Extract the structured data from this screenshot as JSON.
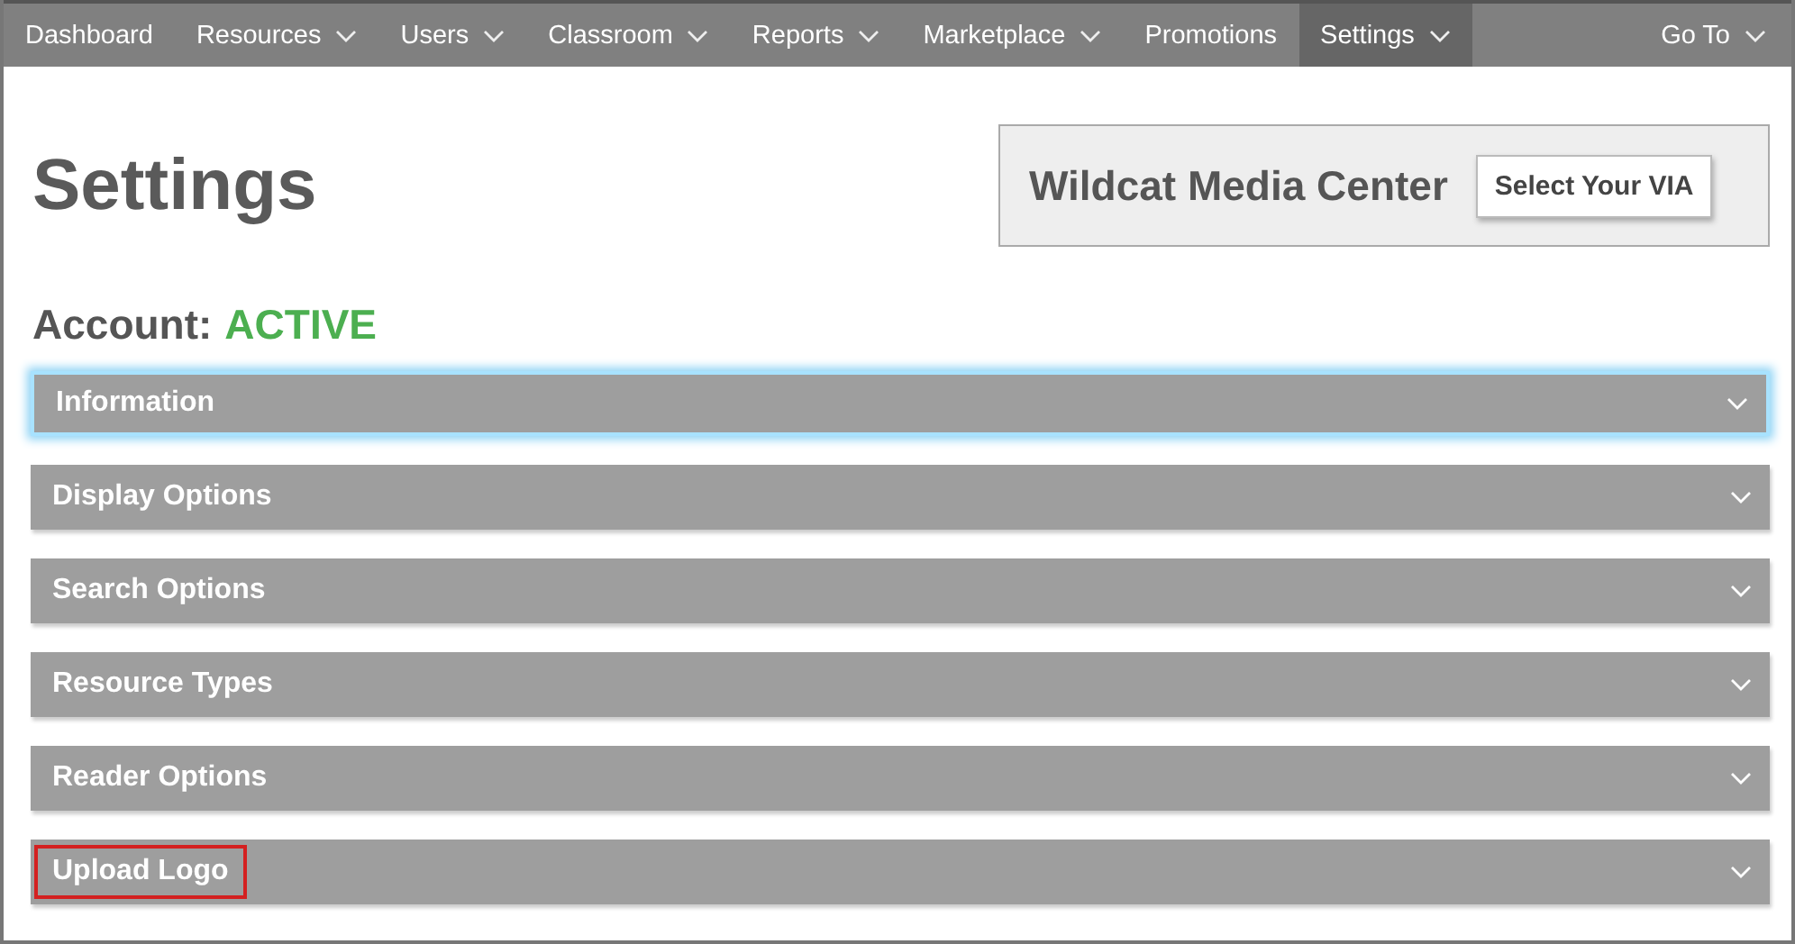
{
  "nav": {
    "items": [
      {
        "label": "Dashboard",
        "has_menu": false,
        "selected": false
      },
      {
        "label": "Resources",
        "has_menu": true,
        "selected": false
      },
      {
        "label": "Users",
        "has_menu": true,
        "selected": false
      },
      {
        "label": "Classroom",
        "has_menu": true,
        "selected": false
      },
      {
        "label": "Reports",
        "has_menu": true,
        "selected": false
      },
      {
        "label": "Marketplace",
        "has_menu": true,
        "selected": false
      },
      {
        "label": "Promotions",
        "has_menu": false,
        "selected": false
      },
      {
        "label": "Settings",
        "has_menu": true,
        "selected": true
      }
    ],
    "goto": {
      "label": "Go To",
      "has_menu": true
    }
  },
  "page_title": "Settings",
  "library": {
    "name": "Wildcat Media Center",
    "button": "Select Your VIA"
  },
  "account": {
    "label": "Account:",
    "status": "ACTIVE"
  },
  "sections": [
    {
      "title": "Information",
      "focused": true,
      "highlighted": false
    },
    {
      "title": "Display Options",
      "focused": false,
      "highlighted": false
    },
    {
      "title": "Search Options",
      "focused": false,
      "highlighted": false
    },
    {
      "title": "Resource Types",
      "focused": false,
      "highlighted": false
    },
    {
      "title": "Reader Options",
      "focused": false,
      "highlighted": false
    },
    {
      "title": "Upload Logo",
      "focused": false,
      "highlighted": true
    }
  ]
}
